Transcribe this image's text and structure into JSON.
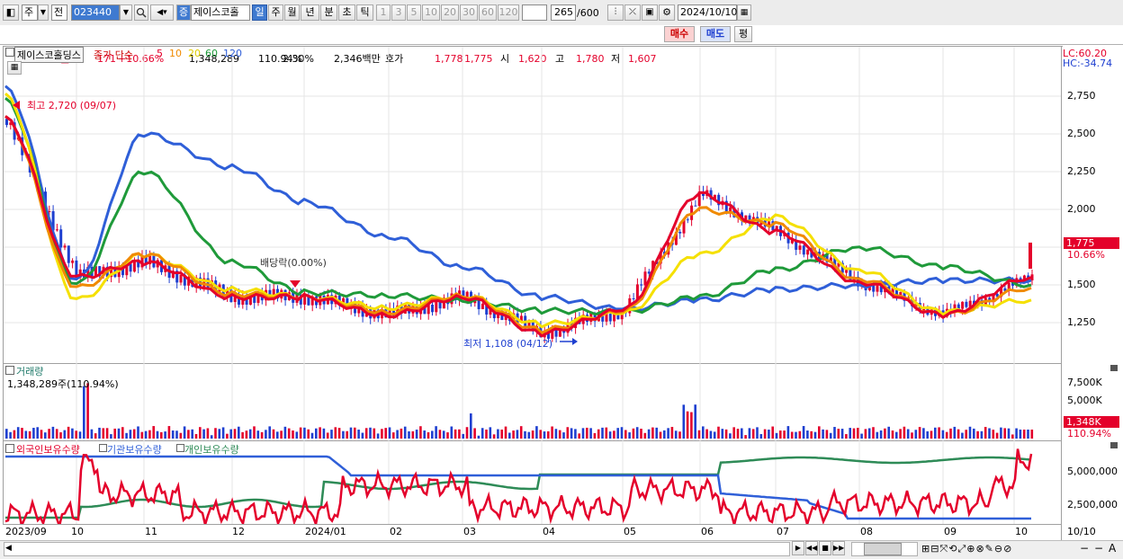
{
  "toolbar": {
    "market": "주",
    "period_mode": "전",
    "code": "023440",
    "sector_badge": "증",
    "stock_name": "제이스코홀",
    "tabs": [
      "일",
      "주",
      "월",
      "년",
      "분",
      "초",
      "틱"
    ],
    "periods": [
      "1",
      "3",
      "5",
      "10",
      "20",
      "30",
      "60",
      "120"
    ],
    "count": "265",
    "count_max": "/600",
    "date": "2024/10/10"
  },
  "quote": {
    "price": "1,775",
    "arrow": "▲",
    "change": "171",
    "change_pct": "+10.66%",
    "volume": "1,348,289",
    "volume_pct": "110.94%",
    "turnover": "2.30%",
    "amount": "2,346백만",
    "hoga_label": "호가",
    "ask": "1,778",
    "bid": "1,775",
    "open_label": "시",
    "open": "1,620",
    "high_label": "고",
    "high": "1,780",
    "low_label": "저",
    "low": "1,607",
    "buy": "매수",
    "sell": "매도",
    "eval": "평"
  },
  "price_panel": {
    "title": "제이스코홀딩스",
    "ma_label": "종가 단순",
    "ma_periods": [
      "5",
      "10",
      "20",
      "60",
      "120"
    ],
    "lc": "LC:60.20",
    "hc": "HC:-34.74",
    "y_ticks": [
      "2,750",
      "2,500",
      "2,250",
      "2,000",
      "1,750",
      "1,500",
      "1,250"
    ],
    "last_price_tag": "1,775",
    "last_pct_tag": "10.66%",
    "high_annot": "최고 2,720 (09/07)",
    "low_annot": "최저 1,108 (04/12)",
    "dividend_annot": "배당락(0.00%)"
  },
  "volume_panel": {
    "title": "거래량",
    "value": "1,348,289주(110.94%)",
    "y_ticks": [
      "7,500K",
      "5,000K"
    ],
    "tag": "1,348K",
    "tag_pct": "110.94%"
  },
  "holdings_panel": {
    "legend": [
      "외국인보유수량",
      "기관보유수량",
      "개인보유수량"
    ],
    "y_ticks": [
      "5,000,000",
      "2,500,000"
    ]
  },
  "x_labels": [
    "2023/09",
    "10",
    "11",
    "12",
    "2024/01",
    "02",
    "03",
    "04",
    "05",
    "06",
    "07",
    "08",
    "09",
    "10"
  ],
  "x_right": "10/10",
  "colors": {
    "up": "#e4002b",
    "down": "#1e3fd0",
    "ma5": "#e4002b",
    "ma10": "#f08a00",
    "ma20": "#f5e000",
    "ma60": "#1f9a3a",
    "ma120": "#2f5fd8",
    "foreign": "#e4002b",
    "institution": "#2f5fd8",
    "individual": "#2e8b57"
  },
  "chart_data": {
    "type": "line",
    "title": "제이스코홀딩스",
    "x_range": [
      "2023/09",
      "2024/10/10"
    ],
    "y_range": [
      1100,
      2900
    ],
    "series": [
      {
        "name": "5",
        "values_by_month": {
          "2023/09": 2600,
          "10": 1550,
          "11": 1650,
          "12": 1420,
          "2024/01": 1420,
          "02": 1300,
          "03": 1420,
          "04": 1180,
          "05": 1330,
          "06": 2100,
          "07": 1850,
          "08": 1520,
          "09": 1300
        }
      },
      {
        "name": "10",
        "values_by_month": {
          "2023/09": 2600,
          "10": 1480,
          "11": 1700,
          "12": 1440,
          "2024/01": 1420,
          "02": 1320,
          "03": 1430,
          "04": 1200,
          "05": 1320,
          "06": 2000,
          "07": 1900,
          "08": 1540,
          "09": 1300
        }
      },
      {
        "name": "20",
        "values_by_month": {
          "2023/09": 2750,
          "10": 1400,
          "11": 1700,
          "12": 1470,
          "2024/01": 1420,
          "02": 1350,
          "03": 1430,
          "04": 1240,
          "05": 1310,
          "06": 1700,
          "07": 1950,
          "08": 1600,
          "09": 1320
        }
      },
      {
        "name": "60",
        "values_by_month": {
          "2023/09": 2720,
          "10": 1500,
          "11": 2250,
          "12": 1650,
          "2024/01": 1450,
          "02": 1430,
          "03": 1400,
          "04": 1330,
          "05": 1320,
          "06": 1420,
          "07": 1600,
          "08": 1750,
          "09": 1620
        }
      },
      {
        "name": "120",
        "values_by_month": {
          "2023/09": 2800,
          "10": 1530,
          "11": 2500,
          "12": 2280,
          "2024/01": 2050,
          "02": 1820,
          "03": 1620,
          "04": 1420,
          "05": 1340,
          "06": 1400,
          "07": 1470,
          "08": 1500,
          "09": 1530
        }
      }
    ],
    "volume_peak_month": "10",
    "last_volume": 1348289
  }
}
